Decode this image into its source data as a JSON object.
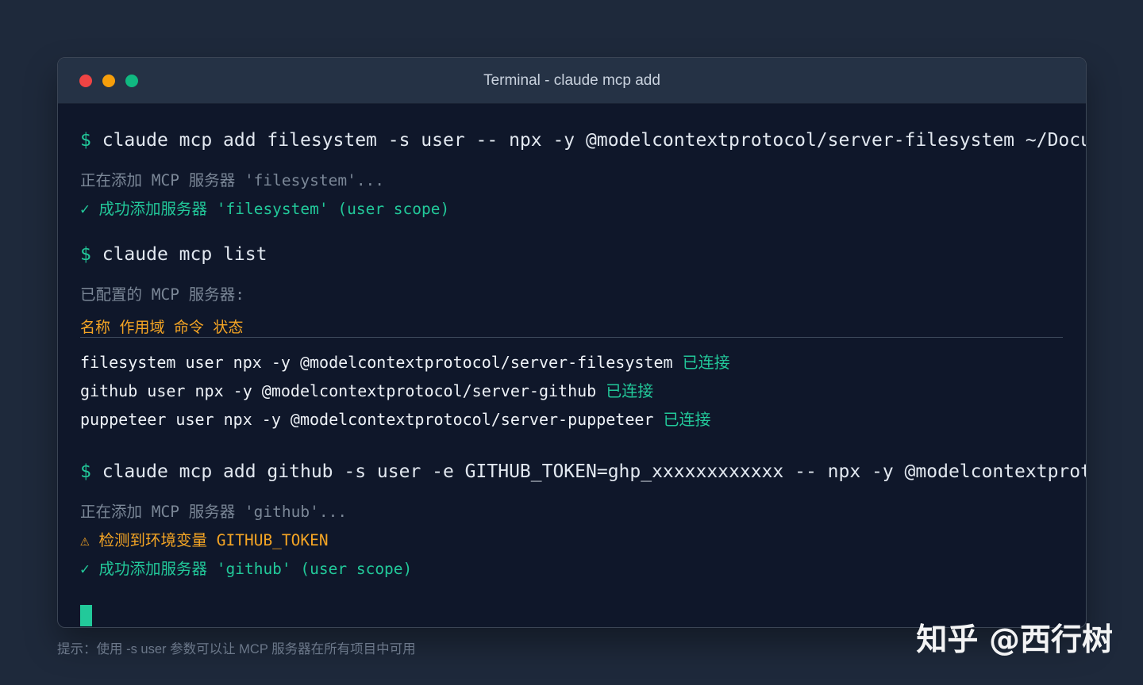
{
  "window": {
    "title": "Terminal - claude mcp add",
    "traffic_lights": {
      "close_color": "#ef4444",
      "minimize_color": "#f59e0b",
      "maximize_color": "#10b981"
    }
  },
  "terminal": {
    "prompt_symbol": "$",
    "block1": {
      "command": "claude mcp add filesystem -s user -- npx -y @modelcontextprotocol/server-filesystem ~/Documents",
      "adding": "正在添加 MCP 服务器 'filesystem'...",
      "check": "✓",
      "success": "成功添加服务器 'filesystem' (user scope)"
    },
    "block2": {
      "command": "claude mcp list",
      "configured": "已配置的 MCP 服务器:",
      "header": "名称 作用域 命令 状态",
      "rows": [
        {
          "text": "filesystem user npx -y @modelcontextprotocol/server-filesystem",
          "status": "已连接"
        },
        {
          "text": "github user npx -y @modelcontextprotocol/server-github",
          "status": "已连接"
        },
        {
          "text": "puppeteer user npx -y @modelcontextprotocol/server-puppeteer",
          "status": "已连接"
        }
      ]
    },
    "block3": {
      "command": "claude mcp add github -s user -e GITHUB_TOKEN=ghp_xxxxxxxxxxxx -- npx -y @modelcontextprotocol/server-github",
      "adding": "正在添加 MCP 服务器 'github'...",
      "warn_icon": "⚠",
      "warning": "检测到环境变量 GITHUB_TOKEN",
      "check": "✓",
      "success": "成功添加服务器 'github' (user scope)"
    },
    "cursor_color": "#22c99a"
  },
  "hint": "提示：使用 -s user 参数可以让 MCP 服务器在所有项目中可用",
  "watermark": "知乎 @西行树"
}
